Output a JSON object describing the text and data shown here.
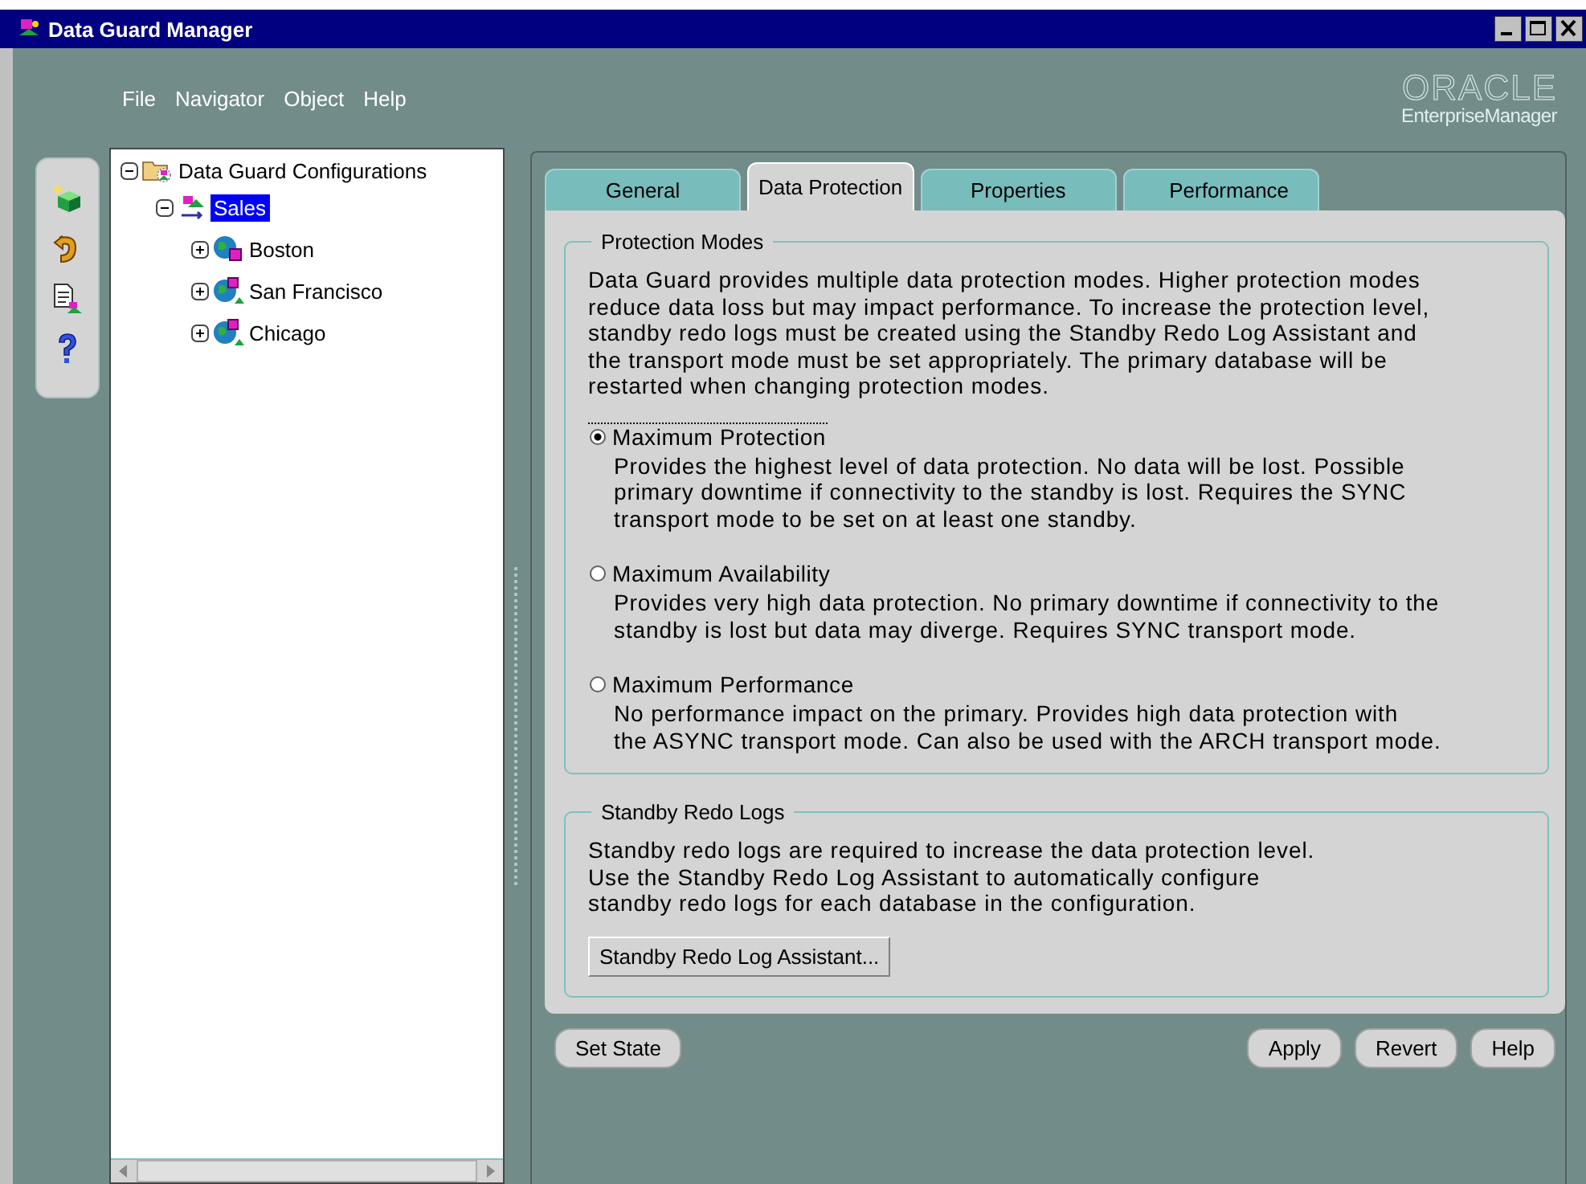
{
  "window": {
    "title": "Data Guard Manager"
  },
  "menu": [
    "File",
    "Navigator",
    "Object",
    "Help"
  ],
  "logo": {
    "brand": "ORACLE",
    "product": "EnterpriseManager"
  },
  "toolbar": [
    {
      "kind": "create"
    },
    {
      "kind": "undo"
    },
    {
      "kind": "report"
    },
    {
      "kind": "help"
    }
  ],
  "tree": {
    "label": "Data Guard Configurations",
    "expanded": true,
    "kind": "folder",
    "selected": false,
    "children": [
      {
        "label": "Sales",
        "expanded": true,
        "kind": "config",
        "selected": true,
        "children": [
          {
            "label": "Boston",
            "expanded": false,
            "kind": "primary",
            "selected": false
          },
          {
            "label": "San Francisco",
            "expanded": false,
            "kind": "standby",
            "selected": false
          },
          {
            "label": "Chicago",
            "expanded": false,
            "kind": "standby",
            "selected": false
          }
        ]
      }
    ]
  },
  "tabs": [
    {
      "label": "General",
      "selected": false
    },
    {
      "label": "Data Protection",
      "selected": true
    },
    {
      "label": "Properties",
      "selected": false
    },
    {
      "label": "Performance",
      "selected": false
    }
  ],
  "protection": {
    "title": "Protection Modes",
    "text": "Data Guard provides multiple data protection modes. Higher protection modes\nreduce data loss but may impact performance. To increase the protection level,\nstandby redo logs must be created using the Standby Redo Log Assistant and\nthe transport mode must be set appropriately. The primary database will be\nrestarted when changing protection modes.",
    "modes": [
      {
        "label": "Maximum Protection",
        "selected": true,
        "description": "Provides the highest level of data protection. No data will be lost. Possible\nprimary downtime if connectivity to the standby is lost. Requires the SYNC\ntransport mode to be set on at least one standby."
      },
      {
        "label": "Maximum Availability",
        "selected": false,
        "description": "Provides very high data protection. No primary downtime if connectivity to the\nstandby is lost but data may diverge. Requires SYNC transport mode."
      },
      {
        "label": "Maximum Performance",
        "selected": false,
        "description": "No performance impact on the primary. Provides high data protection with\nthe ASYNC transport mode. Can also be used with the ARCH transport mode."
      }
    ]
  },
  "standby": {
    "title": "Standby Redo Logs",
    "text": "Standby redo logs are required to increase the data protection level.\nUse the Standby Redo Log Assistant to automatically configure\nstandby redo logs for each database in the configuration.",
    "button": "Standby Redo Log Assistant..."
  },
  "footer": {
    "left": "Set State",
    "right": [
      "Apply",
      "Revert",
      "Help"
    ]
  }
}
